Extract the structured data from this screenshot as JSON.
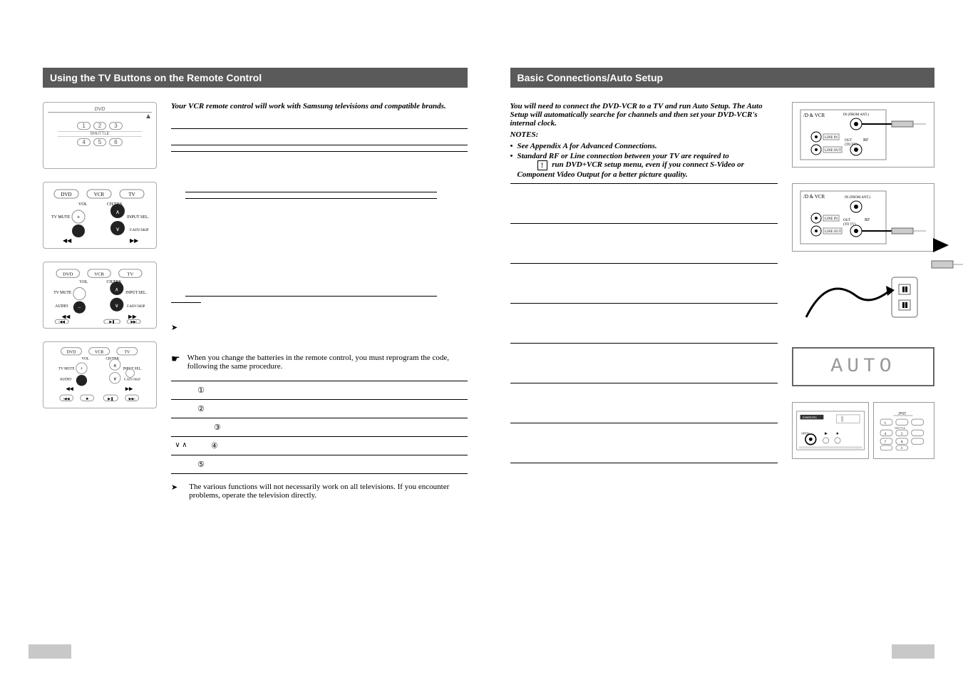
{
  "left": {
    "header": "Using the TV Buttons on the Remote Control",
    "intro": "Your VCR remote control will work with Samsung televisions and compatible brands.",
    "battery_note": "When you change the batteries in the remote control, you must reprogram the code, following the same procedure.",
    "proc": {
      "r1": {
        "n": "①",
        "lab": ""
      },
      "r2": {
        "n": "②",
        "lab": ""
      },
      "r3": {
        "n": "③",
        "lab": ""
      },
      "r4": {
        "n": "④",
        "lab": "∨  ∧"
      },
      "r5": {
        "n": "⑤",
        "lab": ""
      }
    },
    "end_note": "The various functions will not necessarily work on all televisions. If you encounter problems, operate the television directly.",
    "remote": {
      "dvd_label": "DVD",
      "btns_row1": [
        "1",
        "2",
        "3"
      ],
      "btns_row2": [
        "4",
        "5",
        "6"
      ],
      "modes": [
        "DVD",
        "VCR",
        "TV"
      ],
      "labels": {
        "vol": "VOL",
        "chtrk": "CH/TRK",
        "mute": "TV MUTE",
        "input": "INPUT SEL.",
        "audio": "AUDIO",
        "skip": "F.ADV/SKIP",
        "shuttle": "SHUTTLE"
      }
    }
  },
  "right": {
    "header": "Basic Connections/Auto Setup",
    "intro_main": "You will need to connect the DVD-VCR to a TV and run Auto Setup. The Auto Setup will automatically searche for channels and then set your DVD-VCR's internal clock.",
    "notes_label": "NOTES:",
    "note1": "See Appendix A for Advanced Connections.",
    "note2": "Standard RF or Line connection between  your TV are required to",
    "note2b": "run DVD+VCR setup menu, even if you connect S-Video or Component Video Output for a better picture quality.",
    "warn_glyph": "!",
    "lcd_text": "AUTO",
    "conn_labels": {
      "title": "/D & VCR",
      "in": "IN (FROM ANT.)",
      "out": "OUT (TO TV)",
      "rf": "RF",
      "linein": "LINE IN",
      "lineout": "LINE OUT"
    },
    "dvdvcr_panel": {
      "brand": "SAMSUNG",
      "dvd": "DVD",
      "open": "OPEN",
      "play": "▶",
      "stop": "■"
    }
  }
}
